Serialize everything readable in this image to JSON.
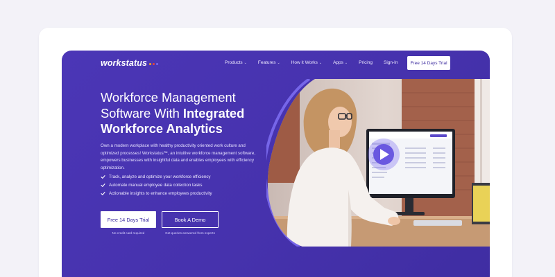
{
  "logo": {
    "text": "workstatus",
    "dot_colors": [
      "#f5a623",
      "#e8413c",
      "#7b6cf0"
    ]
  },
  "nav": {
    "items": [
      {
        "label": "Products",
        "chevron": "⌄"
      },
      {
        "label": "Features",
        "chevron": "⌄"
      },
      {
        "label": "How it Works",
        "chevron": "⌄"
      },
      {
        "label": "Apps",
        "chevron": "⌄"
      },
      {
        "label": "Pricing",
        "chevron": ""
      },
      {
        "label": "Sign-In",
        "chevron": ""
      }
    ],
    "trial_button": "Free 14 Days Trial"
  },
  "hero": {
    "headline_line1": "Workforce Management",
    "headline_line2_regular": "Software With ",
    "headline_line2_bold": "Integrated",
    "headline_line3_bold": "Workforce Analytics",
    "description": "Own a modern workplace with healthy productivity oriented work culture and optimized processes! Workstatus™, an intuitive workforce management software, empowers businesses with insightful data and enables employees with efficiency optimization.",
    "bullets": [
      "Track, analyze and optimize your workforce efficiency",
      "Automate manual employee data collection tasks",
      "Actionable insights to enhance employees productivity"
    ],
    "cta_trial": "Free 14 Days Trial",
    "cta_demo": "Book A Demo",
    "cta_trial_sub": "No credit card required",
    "cta_demo_sub": "Get queries answered from experts"
  },
  "video": {
    "play_icon": "play-icon"
  },
  "colors": {
    "hero_bg": "#4733ae",
    "accent_ring": "#7b6cf0",
    "button_text": "#3d2ca0"
  }
}
